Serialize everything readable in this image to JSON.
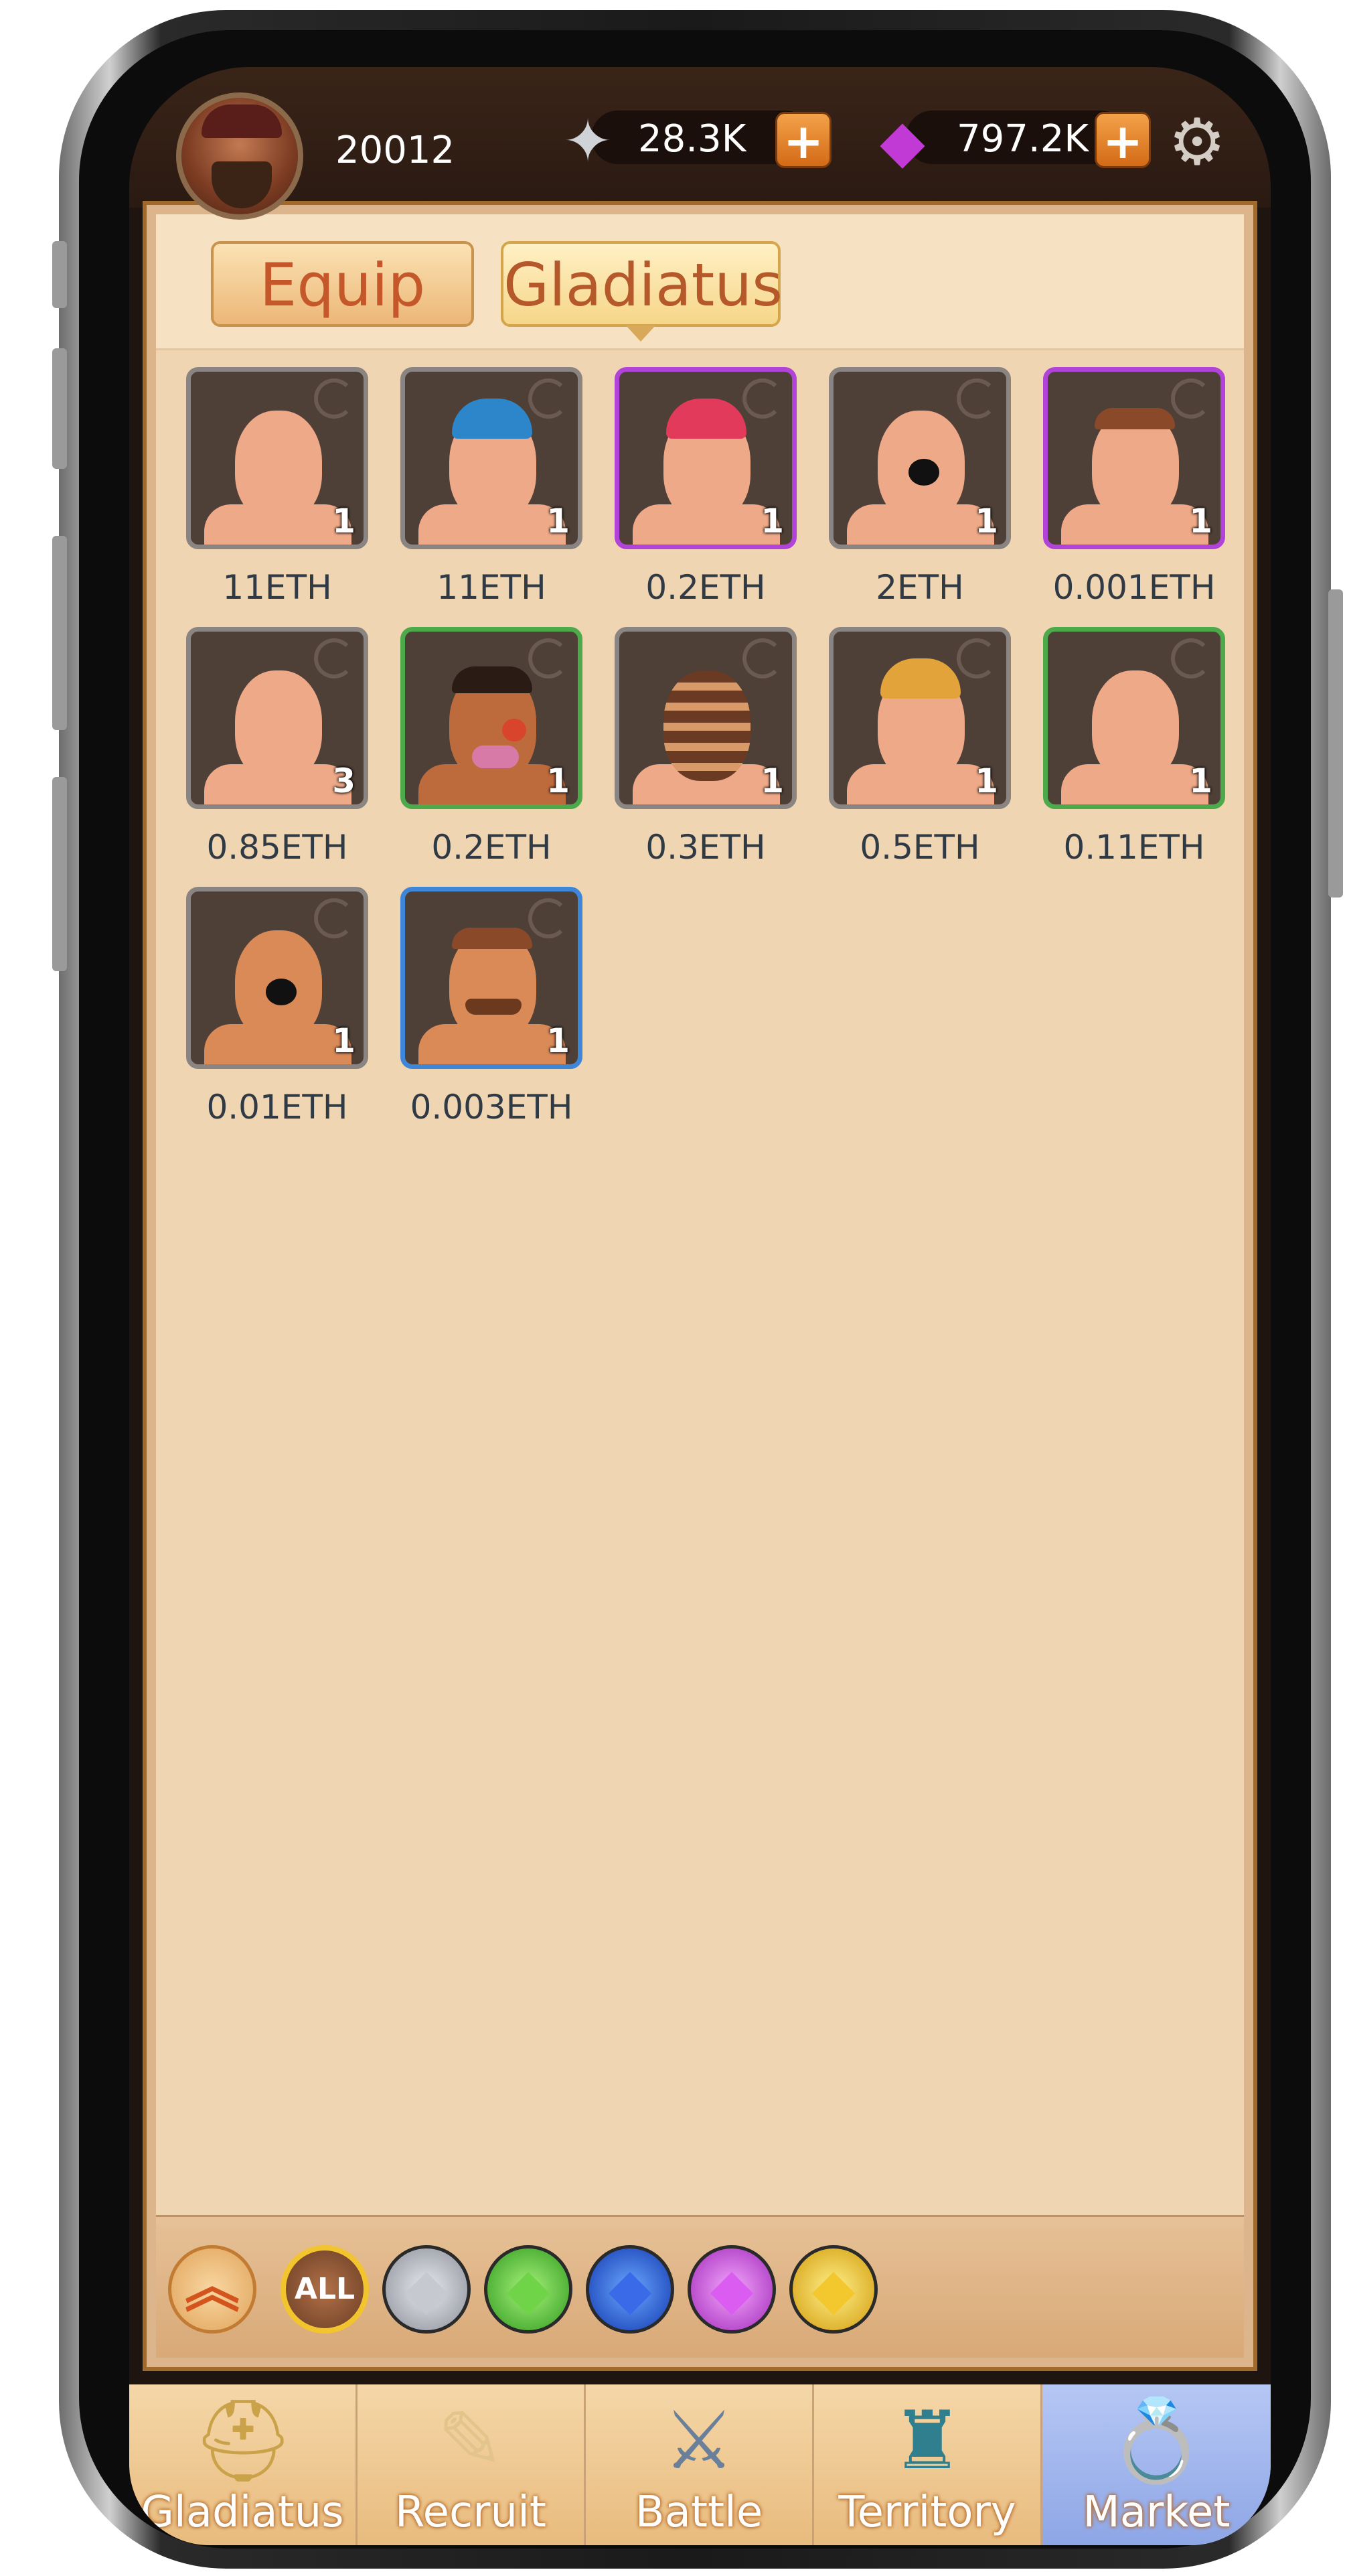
{
  "header": {
    "player_id": "20012",
    "silver": "28.3K",
    "gems": "797.2K"
  },
  "tabs": [
    {
      "label": "Equip",
      "active": false
    },
    {
      "label": "Gladiatus",
      "active": true
    }
  ],
  "gladiators": [
    {
      "price": "11ETH",
      "count": "1",
      "rarity": "gray"
    },
    {
      "price": "11ETH",
      "count": "1",
      "rarity": "gray"
    },
    {
      "price": "0.2ETH",
      "count": "1",
      "rarity": "purple"
    },
    {
      "price": "2ETH",
      "count": "1",
      "rarity": "gray"
    },
    {
      "price": "0.001ETH",
      "count": "1",
      "rarity": "purple"
    },
    {
      "price": "0.85ETH",
      "count": "3",
      "rarity": "gray"
    },
    {
      "price": "0.2ETH",
      "count": "1",
      "rarity": "green"
    },
    {
      "price": "0.3ETH",
      "count": "1",
      "rarity": "gray"
    },
    {
      "price": "0.5ETH",
      "count": "1",
      "rarity": "gray"
    },
    {
      "price": "0.11ETH",
      "count": "1",
      "rarity": "green"
    },
    {
      "price": "0.01ETH",
      "count": "1",
      "rarity": "gray"
    },
    {
      "price": "0.003ETH",
      "count": "1",
      "rarity": "blue"
    }
  ],
  "filters": {
    "all_label": "ALL",
    "gems": [
      "white",
      "green",
      "blue",
      "purple",
      "gold"
    ]
  },
  "nav": [
    {
      "label": "Gladiatus",
      "icon": "helmet-icon"
    },
    {
      "label": "Recruit",
      "icon": "scroll-icon"
    },
    {
      "label": "Battle",
      "icon": "crossed-swords-icon"
    },
    {
      "label": "Territory",
      "icon": "tower-icon"
    },
    {
      "label": "Market",
      "icon": "ring-icon",
      "active": true
    }
  ]
}
